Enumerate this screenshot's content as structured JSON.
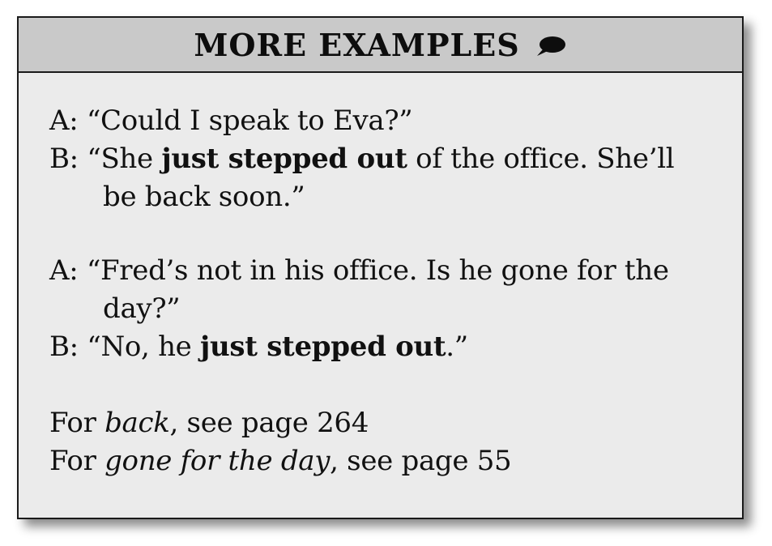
{
  "header": {
    "title": "MORE EXAMPLES"
  },
  "examples": [
    {
      "a_label": "A:",
      "a_text": "“Could I speak to Eva?”",
      "b_label": "B:",
      "b_before": "“She ",
      "b_bold": "just stepped out",
      "b_after": " of the office. She’ll",
      "b_cont": "be back soon.”"
    },
    {
      "a_label": "A:",
      "a_text": "“Fred’s not in his office. Is he gone for the",
      "a_cont": "day?”",
      "b_label": "B:",
      "b_before": "“No, he ",
      "b_bold": "just stepped out",
      "b_after": ".”"
    }
  ],
  "references": [
    {
      "prefix": "For ",
      "term": "back",
      "suffix": ", see page 264"
    },
    {
      "prefix": "For ",
      "term": "gone for the day",
      "suffix": ", see page 55"
    }
  ]
}
